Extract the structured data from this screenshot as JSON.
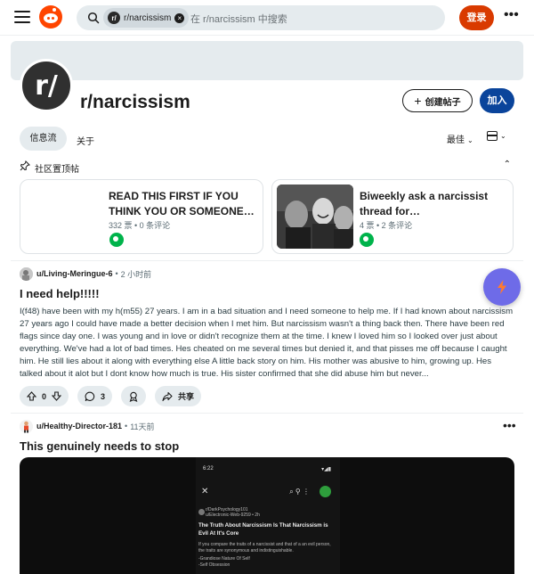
{
  "header": {
    "search_chip": "r/narcissism",
    "search_chip_avatar": "r/",
    "search_placeholder": "在 r/narcissism 中搜索",
    "login_label": "登录",
    "more_label": "•••"
  },
  "community": {
    "icon_text": "r/",
    "name": "r/narcissism",
    "create_post_label": "创建帖子",
    "join_label": "加入"
  },
  "tabs": {
    "feed_label": "信息流",
    "about_label": "关于",
    "sort_label": "最佳"
  },
  "pinned": {
    "label": "社区置顶帖",
    "cards": [
      {
        "title": "READ THIS FIRST IF YOU THINK YOU OR SOMEONE…",
        "meta": "332 票 • 0 条评论"
      },
      {
        "title": "Biweekly ask a narcissist thread for…",
        "meta": "4 票 • 2 条评论"
      }
    ]
  },
  "posts": [
    {
      "author": "u/Living-Meringue-6",
      "time": "2 小时前",
      "title": "I need help!!!!!",
      "body": "I(f48) have been with my h(m55) 27 years. I am in a bad situation and I need someone to help me. If I had known about narcissism 27 years ago I could have made a better decision when I met him. But narcissism wasn't a thing back then. There have been red flags since day one. I was young and in love or didn't recognize them at the time. I knew I loved him so I looked over just about everything. We've had a lot of bad times. Hes cheated on me several times but denied it, and that pisses me off because I caught him. He still lies about it along with everything else A little back story on him. His mother was abusive to him, growing up. Hes talked about it alot but I dont know how much is true. His sister confirmed that she did abuse him but never...",
      "votes": "0",
      "comments": "3",
      "share_label": "共享"
    },
    {
      "author": "u/Healthy-Director-181",
      "time": "11天前",
      "title": "This genuinely needs to stop"
    }
  ],
  "screenshot": {
    "status_time": "6:22",
    "community": "r/DarkPsychology101",
    "user": "u/Electronic-Web-9259 • 2h",
    "headline": "The Truth About Narcissism Is That Narcissism is Evil At It's Core",
    "text": "If you compare the traits of a narcissist and that of a an evil person, the traits are synonymous and indistinguishable.",
    "list1": "-Grandiose Nature Of Self",
    "list2": "-Self Obsession"
  },
  "colors": {
    "brand_orange": "#ff4500",
    "login_button": "#d93a00",
    "join_button": "#0a449b",
    "surface_gray": "#e5ebee",
    "fab_purple": "#6e6be8"
  }
}
